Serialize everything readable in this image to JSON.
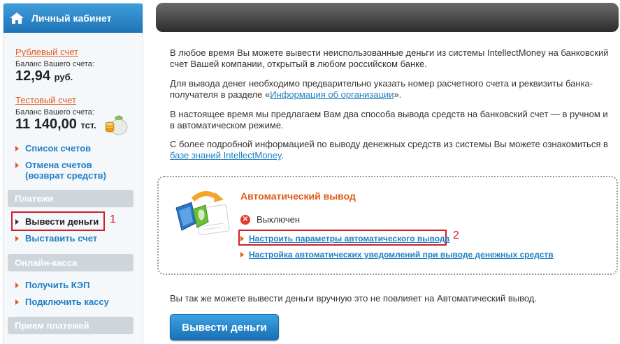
{
  "sidebar": {
    "title": "Личный кабинет",
    "rub_account": {
      "link": "Рублевый счет",
      "balance_label": "Баланс Вашего счета:",
      "balance": "12,94",
      "currency": "руб."
    },
    "test_account": {
      "link": "Тестовый счет",
      "balance_label": "Баланс Вашего счета:",
      "balance": "11 140,00",
      "currency": "тст."
    },
    "account_menu": [
      "Список счетов",
      "Отмена счетов",
      "(возврат средств)"
    ],
    "payments_head": "Платежи",
    "payments_menu": [
      "Вывести деньги",
      "Выставить счет"
    ],
    "cashbox_head": "Онлайн-касса",
    "cashbox_menu": [
      "Получить КЭП",
      "Подключить кассу"
    ],
    "receive_head": "Прием платежей"
  },
  "markers": [
    "1",
    "2"
  ],
  "main": {
    "p1": "В любое время Вы можете вывести неиспользованные деньги из системы IntellectMoney на банковский счет Вашей компании, открытый в любом российском банке.",
    "p2_text": "Для вывода денег необходимо предварительно указать номер расчетного счета и реквизиты банка-получателя в разделе «",
    "p2_link": "Информация об организации",
    "p2_end": "».",
    "p3": "В настоящее время мы предлагаем Вам два способа вывода средств на банковский счет — в ручном и в автоматическом режиме.",
    "p4_text": "С более подробной информацией по выводу денежных средств из системы Вы можете ознакомиться в ",
    "p4_link": "базе знаний IntellectMoney",
    "p4_end": ".",
    "auto": {
      "title": "Автоматический вывод",
      "status": "Выключен",
      "link_settings": "Настроить параметры автоматического вывода",
      "link_notifications": "Настройка автоматических уведомлений при выводе денежных средств"
    },
    "bottom_text": "Вы так же можете вывести деньги вручную это не повлияет на Автоматический вывод.",
    "withdraw_button": "Вывести деньги"
  },
  "colors": {
    "accent_orange": "#e2591a",
    "link_blue": "#1f7fc2",
    "highlight_red": "#d11f2a",
    "header_blue": "#1f74b8"
  }
}
